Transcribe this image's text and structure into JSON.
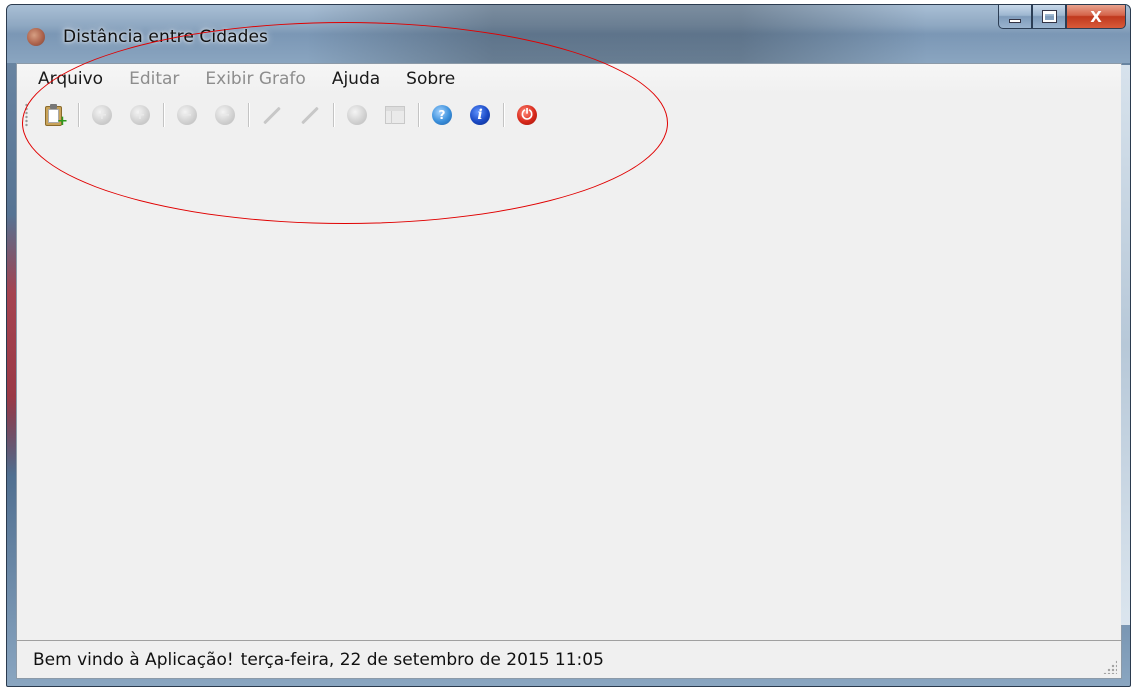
{
  "window": {
    "title": "Distância entre Cidades",
    "close_glyph": "X"
  },
  "menubar": {
    "items": [
      {
        "label": "Arquivo",
        "enabled": true
      },
      {
        "label": "Editar",
        "enabled": false
      },
      {
        "label": "Exibir Grafo",
        "enabled": false
      },
      {
        "label": "Ajuda",
        "enabled": true
      },
      {
        "label": "Sobre",
        "enabled": true
      }
    ]
  },
  "toolbar": {
    "icons": [
      "new-clipboard-icon",
      "add-city-icon",
      "add-route-icon",
      "remove-city-icon",
      "remove-route-icon",
      "edit-city-icon",
      "edit-route-icon",
      "calculate-icon",
      "table-icon",
      "help-icon",
      "info-icon",
      "power-icon"
    ],
    "glyphs": {
      "help": "?",
      "info": "i",
      "power": "⏻",
      "plus": "+",
      "minus": "−"
    }
  },
  "statusbar": {
    "message": "Bem vindo à Aplicação!",
    "datetime": "terça-feira, 22 de setembro de 2015  11:05"
  },
  "colors": {
    "annotation": "#e00000",
    "client_bg": "#f0f0f0",
    "disabled_text": "#8d8d8d"
  }
}
